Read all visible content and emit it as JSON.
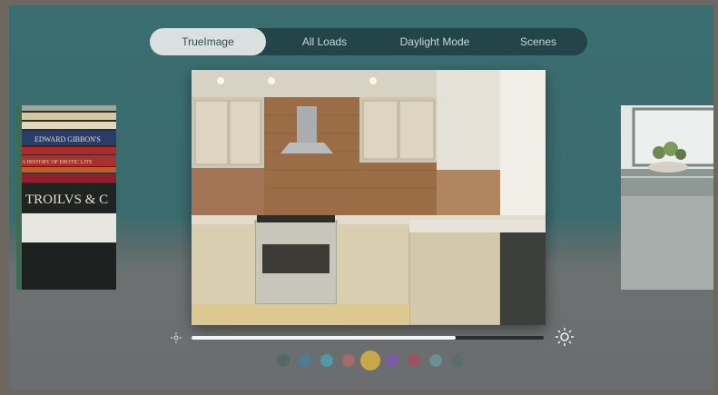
{
  "tabs": [
    {
      "label": "TrueImage",
      "active": true
    },
    {
      "label": "All Loads",
      "active": false
    },
    {
      "label": "Daylight Mode",
      "active": false
    },
    {
      "label": "Scenes",
      "active": false
    }
  ],
  "carousel": {
    "left_card": {
      "book_titles": [
        "EDWARD GIBBON'S",
        "A HISTORY OF EROTIC LITE",
        "TROILVS & C"
      ]
    },
    "main_card": {
      "subject": "kitchen"
    },
    "right_card": {
      "subject": "window with plant"
    }
  },
  "brightness": {
    "level": 0.75
  },
  "colors": {
    "accent_selected": "#c9a84a",
    "swatches": [
      "#556868",
      "#4f7c92",
      "#4e98a8",
      "#a36a6a",
      "#c9a84a",
      "#7c5aa6",
      "#a05063",
      "#6b8f95",
      "#5d6c6c"
    ],
    "selected_index": 4
  },
  "icons": {
    "brightness_low": "sun-small-icon",
    "brightness_high": "sun-large-icon"
  }
}
